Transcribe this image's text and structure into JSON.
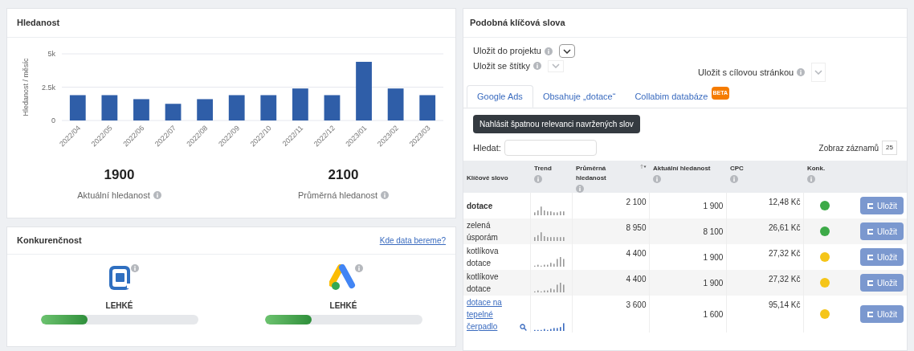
{
  "search_volume": {
    "title": "Hledanost",
    "chart_data": {
      "type": "bar",
      "ylabel": "Hledanost / měsíc",
      "categories": [
        "2022/04",
        "2022/05",
        "2022/06",
        "2022/07",
        "2022/08",
        "2022/09",
        "2022/10",
        "2022/11",
        "2022/12",
        "2023/01",
        "2023/02",
        "2023/03"
      ],
      "series": [
        {
          "color": "#2f5ea8",
          "values": [
            1900,
            1900,
            1600,
            1250,
            1600,
            1900,
            1900,
            2400,
            1900,
            4400,
            2400,
            1900
          ]
        }
      ],
      "ylim": [
        0,
        5000
      ],
      "yticks": [
        {
          "value": 0,
          "label": "0"
        },
        {
          "value": 2500,
          "label": "2.5k"
        },
        {
          "value": 5000,
          "label": "5k"
        }
      ]
    },
    "stats": [
      {
        "value": "1900",
        "label": "Aktuální hledanost"
      },
      {
        "value": "2100",
        "label": "Průměrná hledanost"
      }
    ]
  },
  "competition": {
    "title": "Konkurenčnost",
    "link": "Kde data bereme?",
    "items": [
      {
        "kind": "collabim",
        "label": "LEHKÉ",
        "level": 0.3
      },
      {
        "kind": "google_ads",
        "label": "LEHKÉ",
        "level": 0.3
      }
    ]
  },
  "similar_keywords": {
    "title": "Podobná klíčová slova",
    "save_project": "Uložit do projektu",
    "save_tags": "Uložit se štítky",
    "save_page": "Uložit s cílovou stránkou",
    "tabs": [
      {
        "label": "Google Ads",
        "selected": true
      },
      {
        "label": "Obsahuje „dotace“",
        "selected": false
      },
      {
        "label": "Collabim databáze",
        "selected": false,
        "badge": "BETA"
      }
    ],
    "report_button": "Nahlásit špatnou relevanci navržených slov",
    "search_label": "Hledat:",
    "page_size_label": "Zobraz záznamů",
    "page_size": "25",
    "columns": [
      "Klíčové slovo",
      "Trend",
      "Průměrná hledanost",
      "Aktuální hledanost",
      "CPC",
      "Konk."
    ],
    "rows": [
      {
        "keyword": "dotace",
        "kind": "bold",
        "avg": "2 100",
        "current": "1 900",
        "cpc": "12,48 Kč",
        "color": "#3daa48",
        "action": "Uložit"
      },
      {
        "keyword": "zelená úsporám",
        "kind": "plain",
        "avg": "8 950",
        "current": "8 100",
        "cpc": "26,61 Kč",
        "color": "#3daa48",
        "action": "Uložit"
      },
      {
        "keyword": "kotlíkova dotace",
        "kind": "plain",
        "avg": "4 400",
        "current": "1 900",
        "cpc": "27,32 Kč",
        "color": "#f5c518",
        "action": "Uložit"
      },
      {
        "keyword": "kotlíkove dotace",
        "kind": "plain",
        "avg": "4 400",
        "current": "1 900",
        "cpc": "27,32 Kč",
        "color": "#f5c518",
        "action": "Uložit"
      },
      {
        "keyword": "dotace na tepelné čerpadlo",
        "kind": "link",
        "avg": "3 600",
        "current": "1 600",
        "cpc": "95,14 Kč",
        "color": "#f5c518",
        "action": "Uložit"
      }
    ]
  }
}
